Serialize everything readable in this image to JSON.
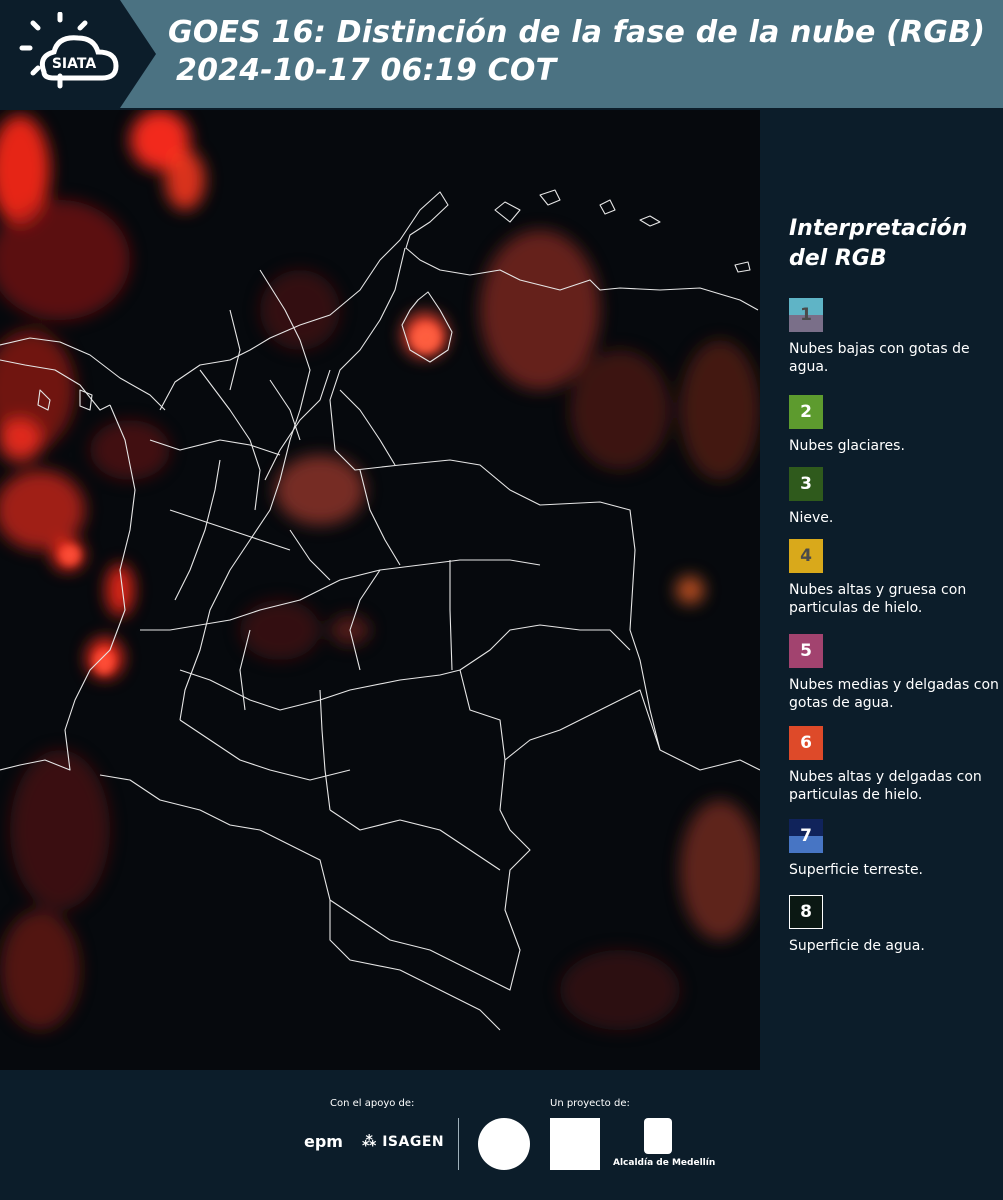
{
  "header": {
    "logo_text": "SIATA",
    "title_line1": "GOES 16: Distinción de la fase de la nube (RGB)",
    "title_line2": "2024-10-17 06:19 COT"
  },
  "legend": {
    "title_line1": "Interpretación",
    "title_line2": "del RGB",
    "items": [
      {
        "num": "1",
        "label": "Nubes bajas con gotas de agua.",
        "color_top": "#5fb4c6",
        "color_bottom": "#7a6f89"
      },
      {
        "num": "2",
        "label": "Nubes glaciares.",
        "color": "#5d9b2e"
      },
      {
        "num": "3",
        "label": "Nieve.",
        "color": "#2f5a1c"
      },
      {
        "num": "4",
        "label": "Nubes altas y gruesa con particulas de hielo.",
        "color": "#d9a91b"
      },
      {
        "num": "5",
        "label": "Nubes medias y delgadas con gotas de agua.",
        "color": "#a2436f"
      },
      {
        "num": "6",
        "label": "Nubes altas y delgadas con particulas de hielo.",
        "color": "#de4a29"
      },
      {
        "num": "7",
        "label": "Superficie terreste.",
        "color_top": "#10235b",
        "color_bottom": "#4775c4"
      },
      {
        "num": "8",
        "label": "Superficie de agua.",
        "color": "#0b1813"
      }
    ]
  },
  "footer": {
    "support_label": "Con el apoyo de:",
    "project_label": "Un proyecto de:",
    "sponsor1": "epm",
    "sponsor2": "ISAGEN",
    "partner3": "Alcaldía de Medellín"
  }
}
